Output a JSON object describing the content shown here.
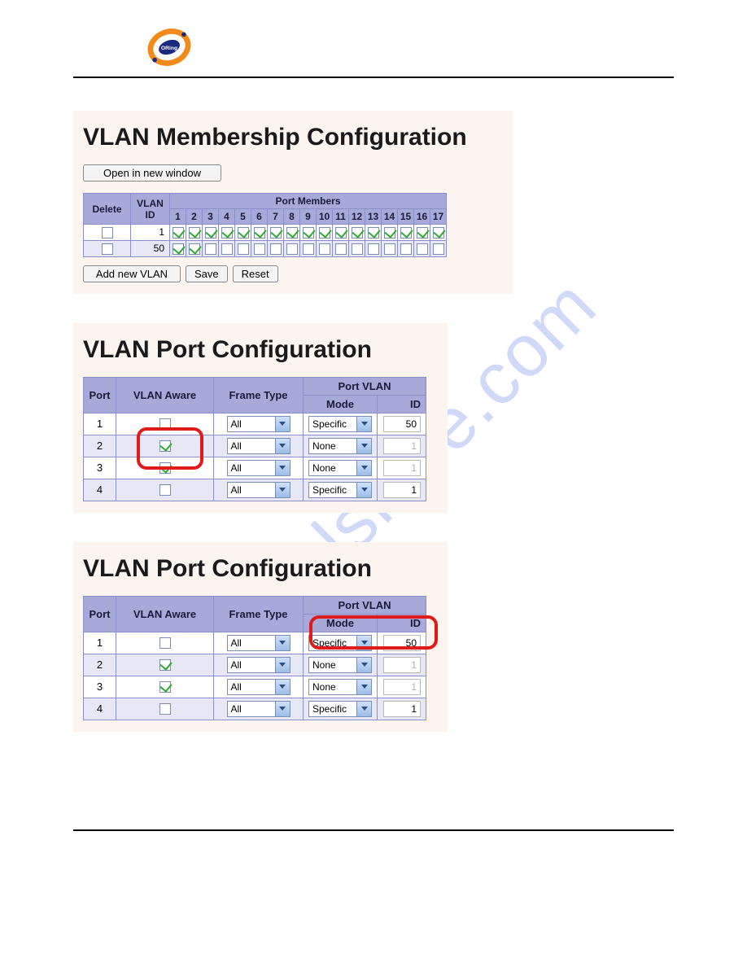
{
  "logo_text": "ORing",
  "watermark": "manualshive.com",
  "membership": {
    "heading": "VLAN Membership Configuration",
    "open_btn": "Open in new window",
    "add_btn": "Add new VLAN",
    "save_btn": "Save",
    "reset_btn": "Reset",
    "headers": {
      "delete": "Delete",
      "vlan_id": "VLAN ID",
      "port_members": "Port Members"
    },
    "ports": [
      "1",
      "2",
      "3",
      "4",
      "5",
      "6",
      "7",
      "8",
      "9",
      "10",
      "11",
      "12",
      "13",
      "14",
      "15",
      "16",
      "17"
    ],
    "rows": [
      {
        "delete": false,
        "vlan_id": "1",
        "members": [
          true,
          true,
          true,
          true,
          true,
          true,
          true,
          true,
          true,
          true,
          true,
          true,
          true,
          true,
          true,
          true,
          true
        ]
      },
      {
        "delete": false,
        "vlan_id": "50",
        "members": [
          true,
          true,
          false,
          false,
          false,
          false,
          false,
          false,
          false,
          false,
          false,
          false,
          false,
          false,
          false,
          false,
          false
        ]
      }
    ]
  },
  "portcfg_a": {
    "heading": "VLAN Port Configuration",
    "headers": {
      "port": "Port",
      "aware": "VLAN Aware",
      "frame": "Frame Type",
      "pvlan": "Port VLAN",
      "mode": "Mode",
      "id": "ID"
    },
    "rows": [
      {
        "port": "1",
        "aware": false,
        "frame": "All",
        "mode": "Specific",
        "id": "50",
        "dim": false
      },
      {
        "port": "2",
        "aware": true,
        "frame": "All",
        "mode": "None",
        "id": "1",
        "dim": true
      },
      {
        "port": "3",
        "aware": true,
        "frame": "All",
        "mode": "None",
        "id": "1",
        "dim": true
      },
      {
        "port": "4",
        "aware": false,
        "frame": "All",
        "mode": "Specific",
        "id": "1",
        "dim": false
      }
    ]
  },
  "portcfg_b": {
    "heading": "VLAN Port Configuration",
    "headers": {
      "port": "Port",
      "aware": "VLAN Aware",
      "frame": "Frame Type",
      "pvlan": "Port VLAN",
      "mode": "Mode",
      "id": "ID"
    },
    "rows": [
      {
        "port": "1",
        "aware": false,
        "frame": "All",
        "mode": "Specific",
        "id": "50",
        "dim": false
      },
      {
        "port": "2",
        "aware": true,
        "frame": "All",
        "mode": "None",
        "id": "1",
        "dim": true
      },
      {
        "port": "3",
        "aware": true,
        "frame": "All",
        "mode": "None",
        "id": "1",
        "dim": true
      },
      {
        "port": "4",
        "aware": false,
        "frame": "All",
        "mode": "Specific",
        "id": "1",
        "dim": false
      }
    ]
  }
}
